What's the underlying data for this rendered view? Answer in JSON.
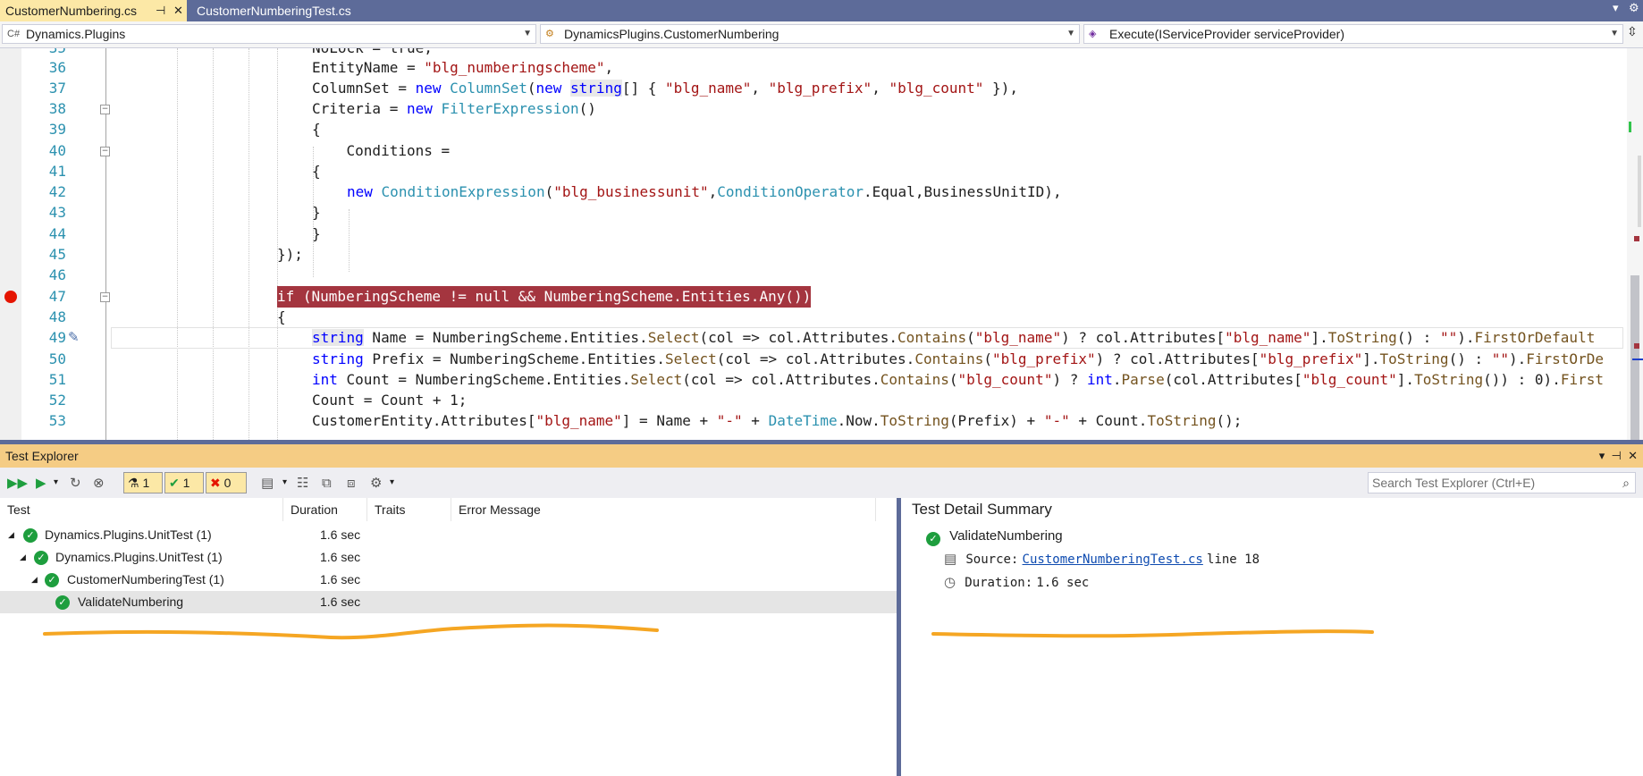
{
  "tabs": [
    {
      "label": "CustomerNumbering.cs",
      "active": true
    },
    {
      "label": "CustomerNumberingTest.cs",
      "active": false
    }
  ],
  "nav": {
    "project": "Dynamics.Plugins",
    "class": "DynamicsPlugins.CustomerNumbering",
    "member": "Execute(IServiceProvider serviceProvider)"
  },
  "editor": {
    "line_numbers": [
      "35",
      "36",
      "37",
      "38",
      "39",
      "40",
      "41",
      "42",
      "43",
      "44",
      "45",
      "46",
      "47",
      "48",
      "49",
      "50",
      "51",
      "52",
      "53"
    ],
    "breakpoint_line": "47"
  },
  "code": {
    "l35": "NoLock = true,",
    "l36": {
      "a": "EntityName = ",
      "b": "\"blg_numberingscheme\"",
      "c": ","
    },
    "l37": {
      "a": "ColumnSet = ",
      "b": "new",
      "c": " ",
      "d": "ColumnSet",
      "e": "(",
      "f": "new",
      "g": " ",
      "h": "string",
      "i": "[] { ",
      "j": "\"blg_name\"",
      "k": ", ",
      "l": "\"blg_prefix\"",
      "m": ", ",
      "n": "\"blg_count\"",
      "o": " }),"
    },
    "l38": {
      "a": "Criteria = ",
      "b": "new",
      "c": " ",
      "d": "FilterExpression",
      "e": "()"
    },
    "l39": "{",
    "l40": "    Conditions =",
    "l41": "{",
    "l42": {
      "a": "new",
      "b": " ",
      "c": "ConditionExpression",
      "d": "(",
      "e": "\"blg_businessunit\"",
      "f": ",",
      "g": "ConditionOperator",
      "h": ".Equal,BusinessUnitID),"
    },
    "l43": "}",
    "l44": "}",
    "l45": "});",
    "l47": "if (NumberingScheme != null && NumberingScheme.Entities.Any())",
    "l48": "{",
    "l49": {
      "a": "string",
      "b": " Name = NumberingScheme.Entities.",
      "c": "Select",
      "d": "(col => col.Attributes.",
      "e": "Contains",
      "f": "(",
      "g": "\"blg_name\"",
      "h": ") ? col.Attributes[",
      "i": "\"blg_name\"",
      "j": "].",
      "k": "ToString",
      "l": "() : ",
      "m": "\"\"",
      "n": ").",
      "o": "FirstOrDefault"
    },
    "l50": {
      "a": "string",
      "b": " Prefix = NumberingScheme.Entities.",
      "c": "Select",
      "d": "(col => col.Attributes.",
      "e": "Contains",
      "f": "(",
      "g": "\"blg_prefix\"",
      "h": ") ? col.Attributes[",
      "i": "\"blg_prefix\"",
      "j": "].",
      "k": "ToString",
      "l": "() : ",
      "m": "\"\"",
      "n": ").",
      "o": "FirstOrDe"
    },
    "l51": {
      "a": "int",
      "b": " Count = NumberingScheme.Entities.",
      "c": "Select",
      "d": "(col => col.Attributes.",
      "e": "Contains",
      "f": "(",
      "g": "\"blg_count\"",
      "h": ") ? ",
      "i": "int",
      "j": ".",
      "k": "Parse",
      "l": "(col.Attributes[",
      "m": "\"blg_count\"",
      "n": "].",
      "o": "ToString",
      "p": "()) : 0).",
      "q": "First"
    },
    "l52": "Count = Count + 1;",
    "l53": {
      "a": "CustomerEntity.Attributes[",
      "b": "\"blg_name\"",
      "c": "] = Name + ",
      "d": "\"-\"",
      "e": " + ",
      "f": "DateTime",
      "g": ".Now.",
      "h": "ToString",
      "i": "(Prefix) + ",
      "j": "\"-\"",
      "k": " + Count.",
      "l": "ToString",
      "m": "();"
    }
  },
  "test_explorer": {
    "title": "Test Explorer",
    "counts": {
      "total": "1",
      "passed": "1",
      "failed": "0"
    },
    "search_placeholder": "Search Test Explorer (Ctrl+E)",
    "columns": [
      "Test",
      "Duration",
      "Traits",
      "Error Message"
    ],
    "rows": [
      {
        "name": "Dynamics.Plugins.UnitTest (1)",
        "duration": "1.6 sec"
      },
      {
        "name": "Dynamics.Plugins.UnitTest (1)",
        "duration": "1.6 sec"
      },
      {
        "name": "CustomerNumberingTest (1)",
        "duration": "1.6 sec"
      },
      {
        "name": "ValidateNumbering",
        "duration": "1.6 sec"
      }
    ]
  },
  "detail": {
    "title": "Test Detail Summary",
    "test_name": "ValidateNumbering",
    "source_label": "Source:",
    "source_link": "CustomerNumberingTest.cs",
    "source_line": "line 18",
    "duration_label": "Duration:",
    "duration_value": "1.6 sec"
  },
  "colors": {
    "tab_active": "#fce8a6",
    "chrome": "#5d6b99",
    "panel_title": "#f5cc84",
    "breakpoint": "#e51400",
    "highlight": "#a4353f",
    "pass": "#1e9e3e",
    "scribble": "#f5a623"
  }
}
